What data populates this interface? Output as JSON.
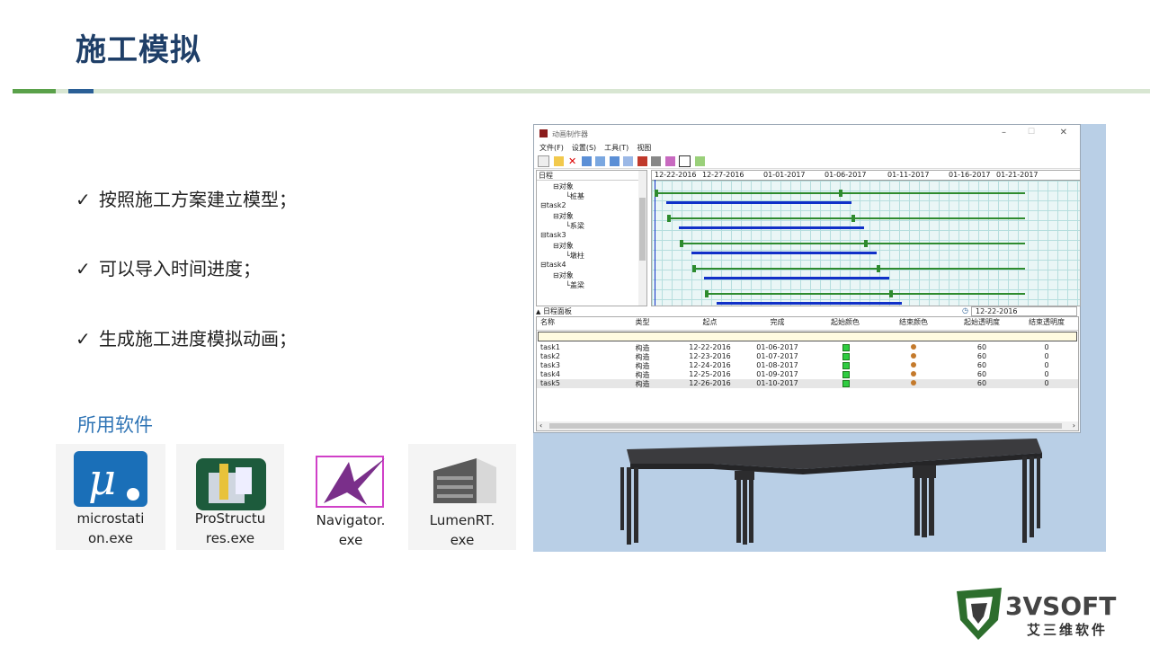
{
  "slide": {
    "title": "施工模拟",
    "bullets": [
      {
        "check": "✓",
        "text": "按照施工方案建立模型；"
      },
      {
        "check": "✓",
        "text": "可以导入时间进度；"
      },
      {
        "check": "✓",
        "text": "生成施工进度模拟动画；"
      }
    ],
    "software_label": "所用软件",
    "software": [
      {
        "name_line1": "microstati",
        "name_line2": "on.exe",
        "icon": "microstation-icon"
      },
      {
        "name_line1": "ProStructu",
        "name_line2": "res.exe",
        "icon": "prostructures-icon"
      },
      {
        "name_line1": "Navigator.",
        "name_line2": "exe",
        "icon": "navigator-icon"
      },
      {
        "name_line1": "LumenRT.",
        "name_line2": "exe",
        "icon": "lumenrt-icon"
      }
    ],
    "logo": {
      "brand": "3VSOFT",
      "cn": "艾三维软件"
    }
  },
  "app": {
    "title": "动画制作器",
    "menu": [
      "文件(F)",
      "设置(S)",
      "工具(T)",
      "视图"
    ],
    "tree_header": "日程",
    "tree": [
      {
        "text": "⊟对象",
        "indent": 2
      },
      {
        "text": "└桩基",
        "indent": 3
      },
      {
        "text": "⊟task2",
        "indent": 1
      },
      {
        "text": "⊟对象",
        "indent": 2
      },
      {
        "text": "└系梁",
        "indent": 3
      },
      {
        "text": "⊟task3",
        "indent": 1
      },
      {
        "text": "⊟对象",
        "indent": 2
      },
      {
        "text": "└墩柱",
        "indent": 3
      },
      {
        "text": "⊟task4",
        "indent": 1
      },
      {
        "text": "⊟对象",
        "indent": 2
      },
      {
        "text": "└盖梁",
        "indent": 3
      }
    ],
    "gantt_dates": [
      "12-22-2016",
      "12-27-2016",
      "01-01-2017",
      "01-06-2017",
      "01-11-2017",
      "01-16-2017",
      "01-21-2017"
    ],
    "panel_title": "日程面板",
    "current_date": "12-22-2016",
    "columns": [
      "名称",
      "类型",
      "起点",
      "完成",
      "起始颜色",
      "结束颜色",
      "起始透明度",
      "结束透明度"
    ],
    "rows": [
      {
        "name": "task1",
        "type": "构造",
        "start": "12-22-2016",
        "end": "01-06-2017",
        "start_alpha": "60",
        "end_alpha": "0"
      },
      {
        "name": "task2",
        "type": "构造",
        "start": "12-23-2016",
        "end": "01-07-2017",
        "start_alpha": "60",
        "end_alpha": "0"
      },
      {
        "name": "task3",
        "type": "构造",
        "start": "12-24-2016",
        "end": "01-08-2017",
        "start_alpha": "60",
        "end_alpha": "0"
      },
      {
        "name": "task4",
        "type": "构造",
        "start": "12-25-2016",
        "end": "01-09-2017",
        "start_alpha": "60",
        "end_alpha": "0"
      },
      {
        "name": "task5",
        "type": "构造",
        "start": "12-26-2016",
        "end": "01-10-2017",
        "start_alpha": "60",
        "end_alpha": "0"
      }
    ]
  },
  "colors": {
    "title": "#1f3f68",
    "accent_green": "#5aa14a",
    "accent_blue": "#2a5f96",
    "gantt_green": "#2e8b2e",
    "gantt_blue": "#1030c8"
  }
}
